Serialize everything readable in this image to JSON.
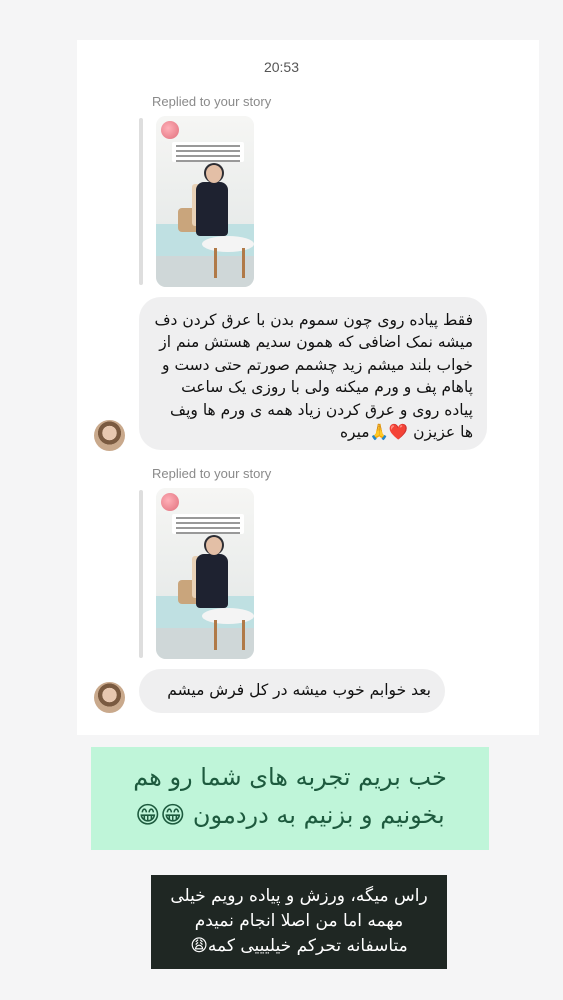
{
  "timestamp": "20:53",
  "messages": [
    {
      "replied_label": "Replied to your story",
      "text": "فقط پیاده روی چون سموم بدن با عرق کردن دف میشه نمک اضافی که همون سدیم هستش منم از خواب بلند میشم زید چشمم صورتم حتی دست و پاهام پف و ورم میکنه ولی با روزی یک ساعت پیاده روی و عرق کردن زیاد همه ی ورم ها وپف ها عزیزن ❤️🙏میره"
    },
    {
      "replied_label": "Replied to your story",
      "text": "بعد خوابم خوب میشه در کل فرش میشم"
    }
  ],
  "banner": {
    "line1": "خب بریم تجربه های شما رو هم",
    "line2": "بخونیم و بزنیم به دردمون 😁😁"
  },
  "reply_box": {
    "line1": "راس میگه، ورزش و پیاده رویم خیلی",
    "line2": "مهمه اما من اصلا انجام نمیدم",
    "line3": "متاسفانه تحرکم خیلیییی کمه😩"
  },
  "colors": {
    "banner_bg": "#bff5d9",
    "banner_text": "#1d5a3e",
    "reply_bg": "#1f2723",
    "bubble_bg": "#efeff0"
  },
  "icons": [
    "story-thumbnail",
    "avatar"
  ]
}
